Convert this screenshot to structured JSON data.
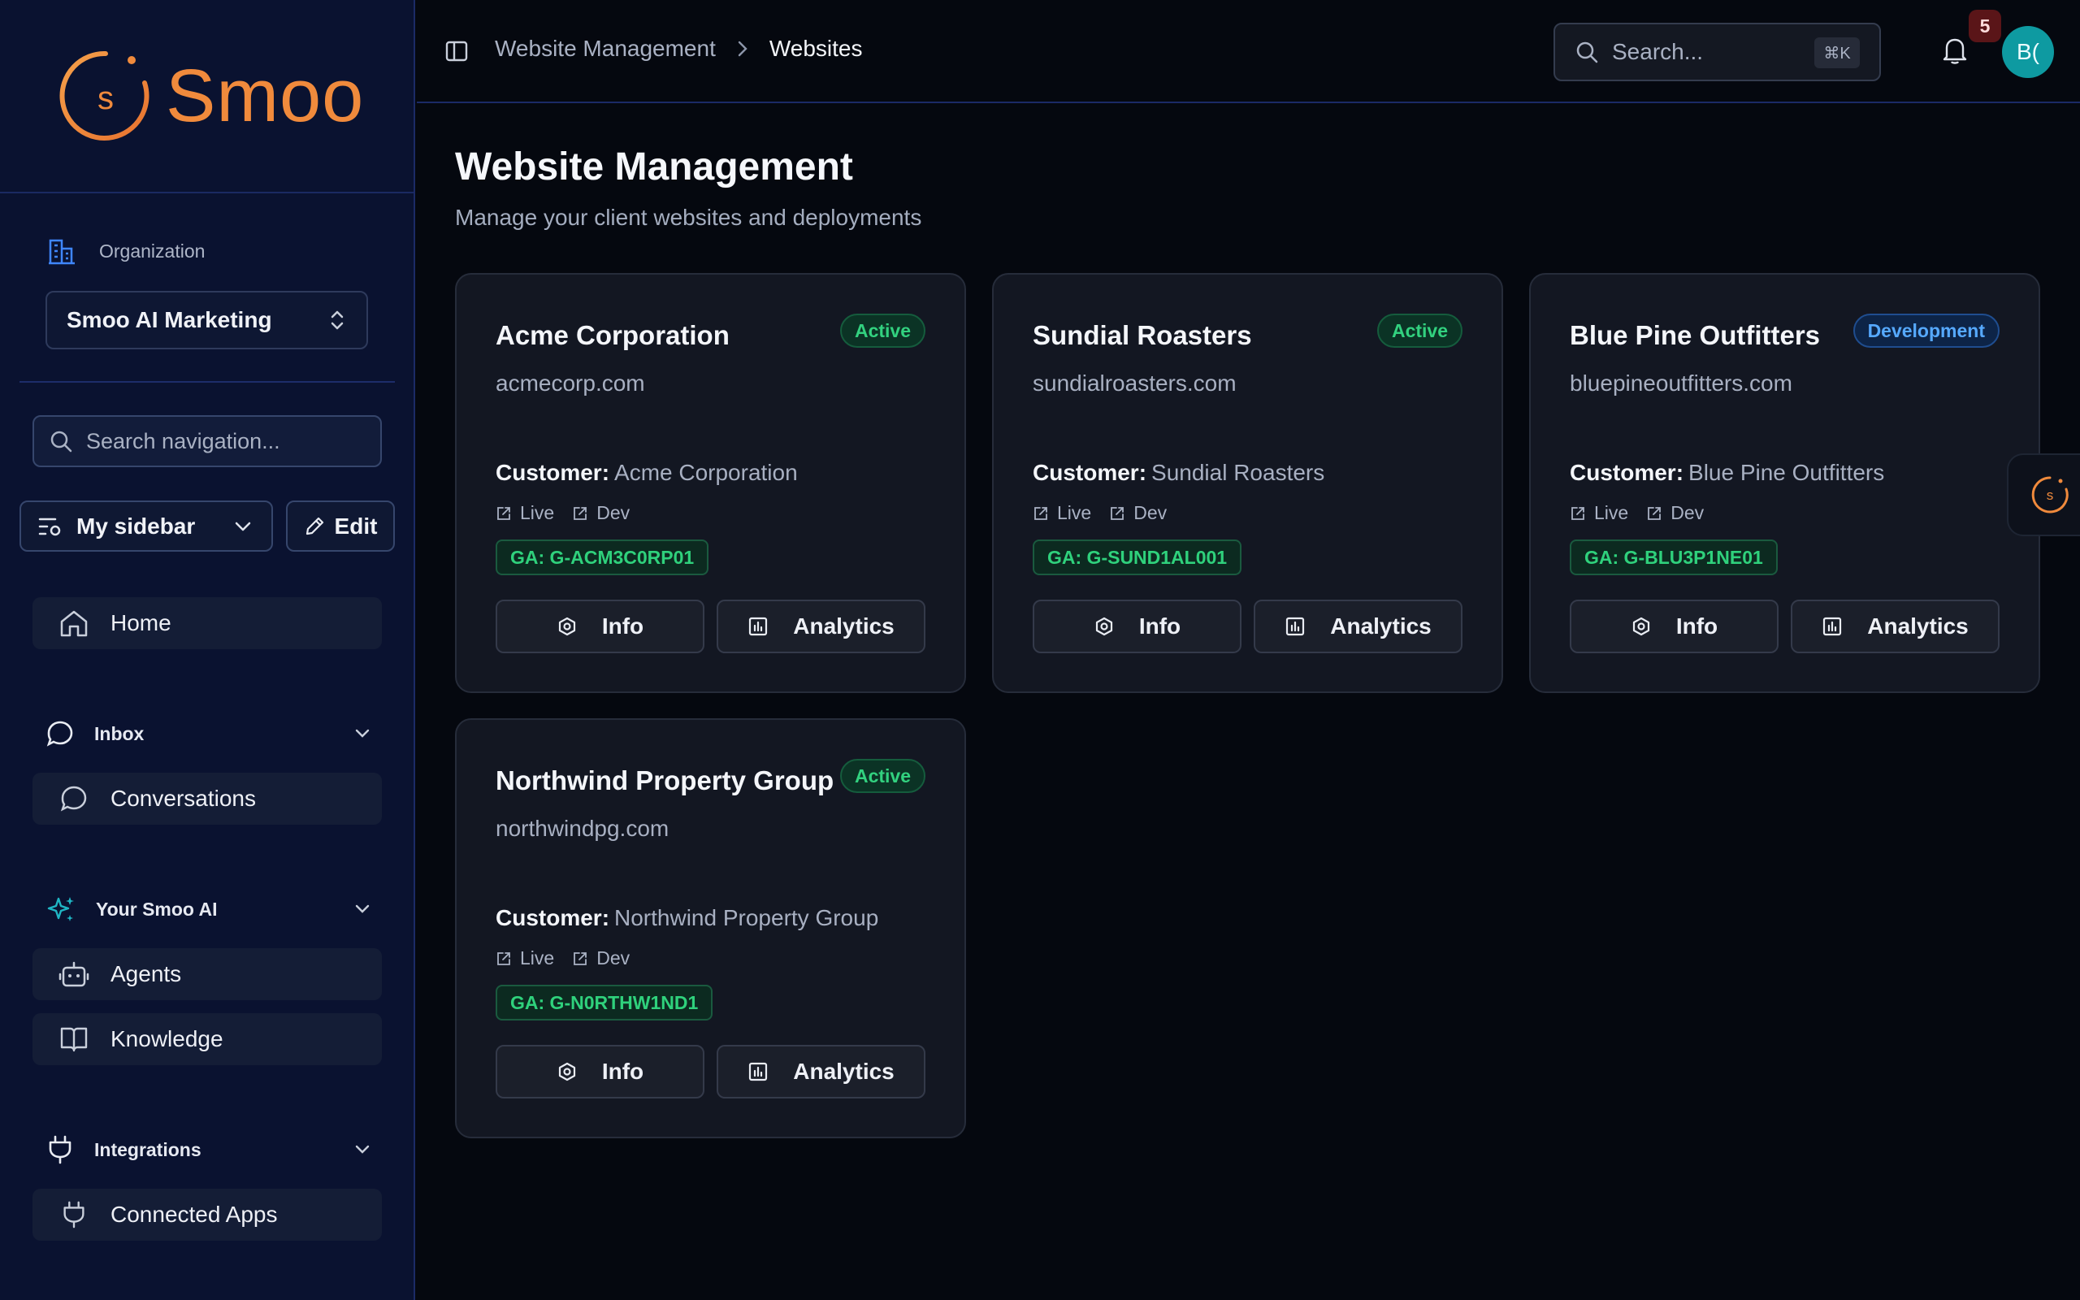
{
  "brand": {
    "name": "Smoo",
    "logo_letter": "s",
    "accent": "#f08a3c"
  },
  "sidebar": {
    "org_label": "Organization",
    "org_selected": "Smoo AI Marketing",
    "search_placeholder": "Search navigation...",
    "view_label": "My sidebar",
    "edit_label": "Edit",
    "home_label": "Home",
    "sections": [
      {
        "label": "Inbox",
        "items": [
          {
            "label": "Conversations",
            "icon": "chat-icon"
          }
        ]
      },
      {
        "label": "Your Smoo AI",
        "items": [
          {
            "label": "Agents",
            "icon": "robot-icon"
          },
          {
            "label": "Knowledge",
            "icon": "book-icon"
          }
        ]
      },
      {
        "label": "Integrations",
        "items": [
          {
            "label": "Connected Apps",
            "icon": "plug-icon"
          }
        ]
      }
    ]
  },
  "header": {
    "breadcrumb": [
      "Website Management",
      "Websites"
    ],
    "search_placeholder": "Search...",
    "search_shortcut": "⌘K",
    "notification_count": "5",
    "avatar_initials": "B("
  },
  "main": {
    "title": "Website Management",
    "subtitle": "Manage your client websites and deployments",
    "customer_label": "Customer:",
    "live_label": "Live",
    "dev_label": "Dev",
    "info_label": "Info",
    "analytics_label": "Analytics",
    "websites": [
      {
        "name": "Acme Corporation",
        "status": "Active",
        "domain": "acmecorp.com",
        "customer": "Acme Corporation",
        "ga": "GA: G-ACM3C0RP01"
      },
      {
        "name": "Sundial Roasters",
        "status": "Active",
        "domain": "sundialroasters.com",
        "customer": "Sundial Roasters",
        "ga": "GA: G-SUND1AL001"
      },
      {
        "name": "Blue Pine Outfitters",
        "status": "Development",
        "domain": "bluepineoutfitters.com",
        "customer": "Blue Pine Outfitters",
        "ga": "GA: G-BLU3P1NE01"
      },
      {
        "name": "Northwind Property Group",
        "status": "Active",
        "domain": "northwindpg.com",
        "customer": "Northwind Property Group",
        "ga": "GA: G-N0RTHW1ND1"
      }
    ]
  },
  "colors": {
    "status_active": "#32d17f",
    "status_development": "#56a9ff",
    "avatar": "#0e9aa1"
  }
}
